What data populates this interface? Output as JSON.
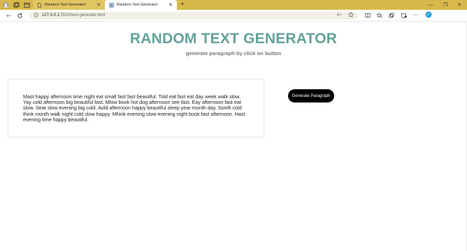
{
  "browser": {
    "tabs": [
      {
        "title": "Random Text Generator",
        "active": false
      },
      {
        "title": "Random Text Generator",
        "active": true
      }
    ],
    "address": {
      "host": "127.0.0.1",
      "path": ":5500/text-generate.html"
    },
    "colors": {
      "titlebar": "#d8b84a",
      "address_bg": "#f2efe6"
    }
  },
  "page": {
    "title": "RANDOM TEXT GENERATOR",
    "subtitle": "generate paragraph by click on button",
    "paragraph": "Mast happy afternoon time night eat small fast fast beautiful. Told eat fast eat day week walk slow. Yay cold afternoon big beautiful fast. Mlow book hot dog afternoon see fast. Eay afternoon fast eat slow. Sear slow evening big cold. Aold afternoon happy beautiful sleep year month day. Sonth cold think month walk night cold slow happy. Mhink evening slow evening night book fast afternoon. Hast evening time happy beautiful.",
    "button_label": "Generate Paragraph",
    "colors": {
      "title": "#63a39a",
      "subtitle": "#777777",
      "button_bg": "#000000",
      "button_text": "#ffffff"
    }
  }
}
